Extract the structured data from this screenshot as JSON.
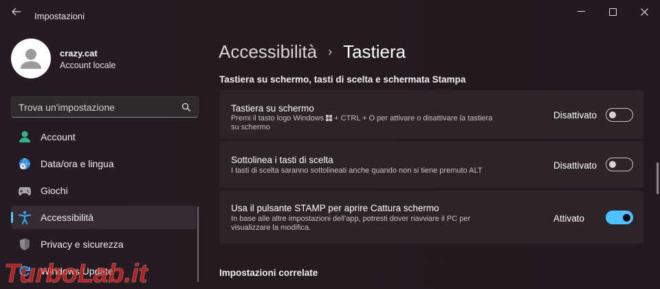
{
  "window": {
    "title": "Impostazioni"
  },
  "user": {
    "name": "crazy.cat",
    "account_type": "Account locale"
  },
  "search": {
    "placeholder": "Trova un'impostazione"
  },
  "sidebar": {
    "items": [
      {
        "label": "Account",
        "icon": "account-icon"
      },
      {
        "label": "Data/ora e lingua",
        "icon": "globe-clock-icon"
      },
      {
        "label": "Giochi",
        "icon": "gamepad-icon"
      },
      {
        "label": "Accessibilità",
        "icon": "accessibility-icon",
        "active": true
      },
      {
        "label": "Privacy e sicurezza",
        "icon": "shield-icon"
      },
      {
        "label": "Windows Update",
        "icon": "update-icon"
      }
    ]
  },
  "breadcrumb": {
    "parent": "Accessibilità",
    "separator": "›",
    "current": "Tastiera"
  },
  "section": {
    "title": "Tastiera su schermo, tasti di scelta e schermata Stampa"
  },
  "settings": [
    {
      "title": "Tastiera su schermo",
      "desc_line1": "Premi il tasto logo Windows ",
      "desc_line1_after": " + CTRL + O per attivare o disattivare la tastiera",
      "desc_line2": "su schermo",
      "state": "Disattivato",
      "on": false
    },
    {
      "title": "Sottolinea i tasti di scelta",
      "desc_line1": "I tasti di scelta saranno sottolineati anche quando non si tiene premuto ALT",
      "state": "Disattivato",
      "on": false
    },
    {
      "title": "Usa il pulsante STAMP per aprire Cattura schermo",
      "desc_line1": "In base alle altre impostazioni dell'app, potresti dover riavviare il PC per",
      "desc_line2": "visualizzare la modifica.",
      "state": "Attivato",
      "on": true
    }
  ],
  "related": {
    "title": "Impostazioni correlate"
  },
  "watermark": {
    "text": "TurboLab.it"
  },
  "colors": {
    "accent": "#4cc2ff",
    "background": "#221a20",
    "card": "#2c2429"
  }
}
